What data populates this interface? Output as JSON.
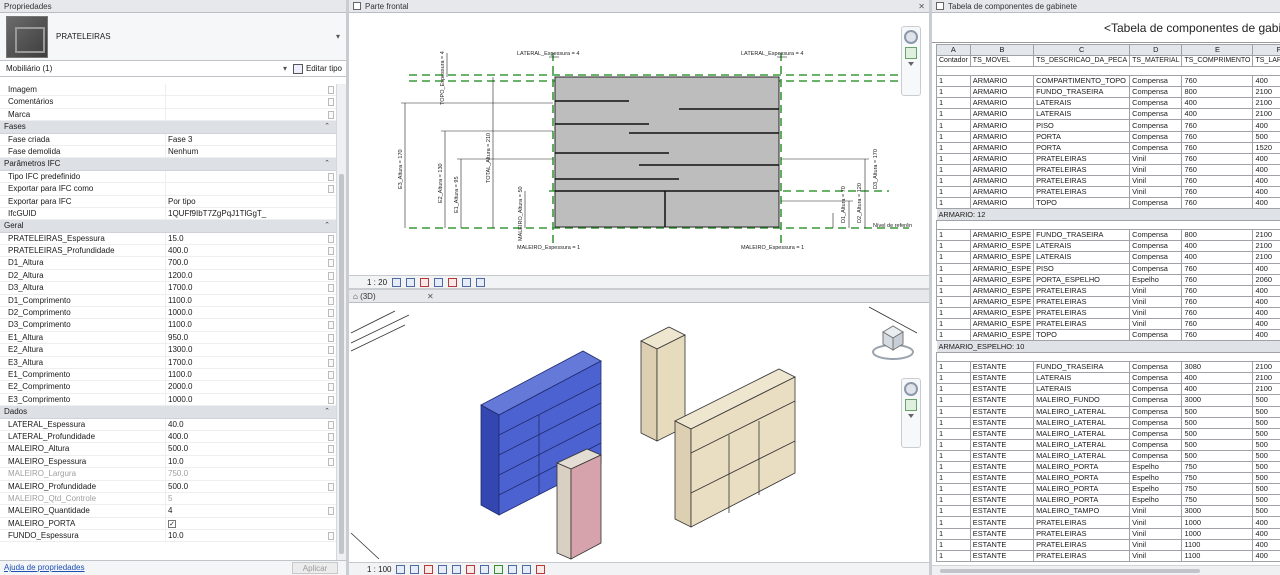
{
  "properties": {
    "title": "Propriedades",
    "type_name": "PRATELEIRAS",
    "instance_filter": "Mobiliário (1)",
    "edit_type_label": "Editar tipo",
    "help_link": "Ajuda de propriedades",
    "apply_label": "Aplicar",
    "rows": [
      {
        "kind": "row",
        "key": "Imagem",
        "value": ""
      },
      {
        "kind": "row",
        "key": "Comentários",
        "value": ""
      },
      {
        "kind": "row",
        "key": "Marca",
        "value": ""
      },
      {
        "kind": "section",
        "key": "Fases"
      },
      {
        "kind": "row",
        "key": "Fase criada",
        "value": "Fase 3"
      },
      {
        "kind": "row",
        "key": "Fase demolida",
        "value": "Nenhum"
      },
      {
        "kind": "section",
        "key": "Parâmetros IFC"
      },
      {
        "kind": "row",
        "key": "Tipo IFC predefinido",
        "value": ""
      },
      {
        "kind": "row",
        "key": "Exportar para IFC como",
        "value": ""
      },
      {
        "kind": "row",
        "key": "Exportar para IFC",
        "value": "Por tipo"
      },
      {
        "kind": "row",
        "key": "IfcGUID",
        "value": "1QUFf9IbT7ZgPqJ1TlGgT_"
      },
      {
        "kind": "section",
        "key": "Geral"
      },
      {
        "kind": "row",
        "key": "PRATELEIRAS_Espessura",
        "value": "15.0"
      },
      {
        "kind": "row",
        "key": "PRATELEIRAS_Profundidade",
        "value": "400.0"
      },
      {
        "kind": "row",
        "key": "D1_Altura",
        "value": "700.0"
      },
      {
        "kind": "row",
        "key": "D2_Altura",
        "value": "1200.0"
      },
      {
        "kind": "row",
        "key": "D3_Altura",
        "value": "1700.0"
      },
      {
        "kind": "row",
        "key": "D1_Comprimento",
        "value": "1100.0"
      },
      {
        "kind": "row",
        "key": "D2_Comprimento",
        "value": "1000.0"
      },
      {
        "kind": "row",
        "key": "D3_Comprimento",
        "value": "1100.0"
      },
      {
        "kind": "row",
        "key": "E1_Altura",
        "value": "950.0"
      },
      {
        "kind": "row",
        "key": "E2_Altura",
        "value": "1300.0"
      },
      {
        "kind": "row",
        "key": "E3_Altura",
        "value": "1700.0"
      },
      {
        "kind": "row",
        "key": "E1_Comprimento",
        "value": "1100.0"
      },
      {
        "kind": "row",
        "key": "E2_Comprimento",
        "value": "2000.0"
      },
      {
        "kind": "row",
        "key": "E3_Comprimento",
        "value": "1000.0"
      },
      {
        "kind": "section",
        "key": "Dados"
      },
      {
        "kind": "row",
        "key": "LATERAL_Espessura",
        "value": "40.0"
      },
      {
        "kind": "row",
        "key": "LATERAL_Profundidade",
        "value": "400.0"
      },
      {
        "kind": "row",
        "key": "MALEIRO_Altura",
        "value": "500.0"
      },
      {
        "kind": "row",
        "key": "MALEIRO_Espessura",
        "value": "10.0"
      },
      {
        "kind": "row",
        "key": "MALEIRO_Largura",
        "value": "750.0",
        "disabled": true
      },
      {
        "kind": "row",
        "key": "MALEIRO_Profundidade",
        "value": "500.0"
      },
      {
        "kind": "row",
        "key": "MALEIRO_Qtd_Controle",
        "value": "5",
        "disabled": true
      },
      {
        "kind": "row",
        "key": "MALEIRO_Quantidade",
        "value": "4"
      },
      {
        "kind": "row",
        "key": "MALEIRO_PORTA",
        "value": "",
        "checkbox": true
      },
      {
        "kind": "row",
        "key": "FUNDO_Espessura",
        "value": "10.0"
      }
    ]
  },
  "front_view": {
    "tab": "Parte frontal",
    "scale": "1 : 20",
    "labels": {
      "lateral_left": "LATERAL_Espessura = 4",
      "lateral_right": "LATERAL_Espessura = 4",
      "topo": "TOPO_Espessura = 4",
      "total": "TOTAL_Altura = 210",
      "e3": "E3_Altura = 170",
      "e2": "E2_Altura = 130",
      "e1": "E1_Altura = 95",
      "maleiro": "MALEIRO_Altura = 50",
      "d3": "D3_Altura = 170",
      "d2": "D2_Altura = 120",
      "d1": "D1_Altura = 70",
      "nivel": "Nível de referên",
      "maleiro_left": "MALEIRO_Espessura = 1",
      "maleiro_right": "MALEIRO_Espessura = 1"
    }
  },
  "view_3d": {
    "tab": "(3D)",
    "scale": "1 : 100"
  },
  "schedule": {
    "tab": "Tabela de componentes de gabinete",
    "title": "<Tabela de componentes de gabinet",
    "column_letters": [
      "A",
      "B",
      "C",
      "D",
      "E",
      "F"
    ],
    "headers": [
      "Contador",
      "TS_MOVEL",
      "TS_DESCRICAO_DA_PECA",
      "TS_MATERIAL",
      "TS_COMPRIMENTO",
      "TS_LARGURA"
    ],
    "rows": [
      {
        "t": "blank"
      },
      {
        "t": "r",
        "c": [
          "1",
          "ARMARIO",
          "COMPARTIMENTO_TOPO",
          "Compensa",
          "760",
          "400"
        ]
      },
      {
        "t": "r",
        "c": [
          "1",
          "ARMARIO",
          "FUNDO_TRASEIRA",
          "Compensa",
          "800",
          "2100"
        ]
      },
      {
        "t": "r",
        "c": [
          "1",
          "ARMARIO",
          "LATERAIS",
          "Compensa",
          "400",
          "2100"
        ]
      },
      {
        "t": "r",
        "c": [
          "1",
          "ARMARIO",
          "LATERAIS",
          "Compensa",
          "400",
          "2100"
        ]
      },
      {
        "t": "r",
        "c": [
          "1",
          "ARMARIO",
          "PISO",
          "Compensa",
          "760",
          "400"
        ]
      },
      {
        "t": "r",
        "c": [
          "1",
          "ARMARIO",
          "PORTA",
          "Compensa",
          "760",
          "500"
        ]
      },
      {
        "t": "r",
        "c": [
          "1",
          "ARMARIO",
          "PORTA",
          "Compensa",
          "760",
          "1520"
        ]
      },
      {
        "t": "r",
        "c": [
          "1",
          "ARMARIO",
          "PRATELEIRAS",
          "Vinil",
          "760",
          "400"
        ]
      },
      {
        "t": "r",
        "c": [
          "1",
          "ARMARIO",
          "PRATELEIRAS",
          "Vinil",
          "760",
          "400"
        ]
      },
      {
        "t": "r",
        "c": [
          "1",
          "ARMARIO",
          "PRATELEIRAS",
          "Vinil",
          "760",
          "400"
        ]
      },
      {
        "t": "r",
        "c": [
          "1",
          "ARMARIO",
          "PRATELEIRAS",
          "Vinil",
          "760",
          "400"
        ]
      },
      {
        "t": "r",
        "c": [
          "1",
          "ARMARIO",
          "TOPO",
          "Compensa",
          "760",
          "400"
        ]
      },
      {
        "t": "g",
        "label": "ARMARIO: 12"
      },
      {
        "t": "blank"
      },
      {
        "t": "r",
        "c": [
          "1",
          "ARMARIO_ESPE",
          "FUNDO_TRASEIRA",
          "Compensa",
          "800",
          "2100"
        ]
      },
      {
        "t": "r",
        "c": [
          "1",
          "ARMARIO_ESPE",
          "LATERAIS",
          "Compensa",
          "400",
          "2100"
        ]
      },
      {
        "t": "r",
        "c": [
          "1",
          "ARMARIO_ESPE",
          "LATERAIS",
          "Compensa",
          "400",
          "2100"
        ]
      },
      {
        "t": "r",
        "c": [
          "1",
          "ARMARIO_ESPE",
          "PISO",
          "Compensa",
          "760",
          "400"
        ]
      },
      {
        "t": "r",
        "c": [
          "1",
          "ARMARIO_ESPE",
          "PORTA_ESPELHO",
          "Espelho",
          "760",
          "2060"
        ]
      },
      {
        "t": "r",
        "c": [
          "1",
          "ARMARIO_ESPE",
          "PRATELEIRAS",
          "Vinil",
          "760",
          "400"
        ]
      },
      {
        "t": "r",
        "c": [
          "1",
          "ARMARIO_ESPE",
          "PRATELEIRAS",
          "Vinil",
          "760",
          "400"
        ]
      },
      {
        "t": "r",
        "c": [
          "1",
          "ARMARIO_ESPE",
          "PRATELEIRAS",
          "Vinil",
          "760",
          "400"
        ]
      },
      {
        "t": "r",
        "c": [
          "1",
          "ARMARIO_ESPE",
          "PRATELEIRAS",
          "Vinil",
          "760",
          "400"
        ]
      },
      {
        "t": "r",
        "c": [
          "1",
          "ARMARIO_ESPE",
          "TOPO",
          "Compensa",
          "760",
          "400"
        ]
      },
      {
        "t": "g",
        "label": "ARMARIO_ESPELHO: 10"
      },
      {
        "t": "blank"
      },
      {
        "t": "r",
        "c": [
          "1",
          "ESTANTE",
          "FUNDO_TRASEIRA",
          "Compensa",
          "3080",
          "2100"
        ]
      },
      {
        "t": "r",
        "c": [
          "1",
          "ESTANTE",
          "LATERAIS",
          "Compensa",
          "400",
          "2100"
        ]
      },
      {
        "t": "r",
        "c": [
          "1",
          "ESTANTE",
          "LATERAIS",
          "Compensa",
          "400",
          "2100"
        ]
      },
      {
        "t": "r",
        "c": [
          "1",
          "ESTANTE",
          "MALEIRO_FUNDO",
          "Compensa",
          "3000",
          "500"
        ]
      },
      {
        "t": "r",
        "c": [
          "1",
          "ESTANTE",
          "MALEIRO_LATERAL",
          "Compensa",
          "500",
          "500"
        ]
      },
      {
        "t": "r",
        "c": [
          "1",
          "ESTANTE",
          "MALEIRO_LATERAL",
          "Compensa",
          "500",
          "500"
        ]
      },
      {
        "t": "r",
        "c": [
          "1",
          "ESTANTE",
          "MALEIRO_LATERAL",
          "Compensa",
          "500",
          "500"
        ]
      },
      {
        "t": "r",
        "c": [
          "1",
          "ESTANTE",
          "MALEIRO_LATERAL",
          "Compensa",
          "500",
          "500"
        ]
      },
      {
        "t": "r",
        "c": [
          "1",
          "ESTANTE",
          "MALEIRO_LATERAL",
          "Compensa",
          "500",
          "500"
        ]
      },
      {
        "t": "r",
        "c": [
          "1",
          "ESTANTE",
          "MALEIRO_PORTA",
          "Espelho",
          "750",
          "500"
        ]
      },
      {
        "t": "r",
        "c": [
          "1",
          "ESTANTE",
          "MALEIRO_PORTA",
          "Espelho",
          "750",
          "500"
        ]
      },
      {
        "t": "r",
        "c": [
          "1",
          "ESTANTE",
          "MALEIRO_PORTA",
          "Espelho",
          "750",
          "500"
        ]
      },
      {
        "t": "r",
        "c": [
          "1",
          "ESTANTE",
          "MALEIRO_PORTA",
          "Espelho",
          "750",
          "500"
        ]
      },
      {
        "t": "r",
        "c": [
          "1",
          "ESTANTE",
          "MALEIRO_TAMPO",
          "Vinil",
          "3000",
          "500"
        ]
      },
      {
        "t": "r",
        "c": [
          "1",
          "ESTANTE",
          "PRATELEIRAS",
          "Vinil",
          "1000",
          "400"
        ]
      },
      {
        "t": "r",
        "c": [
          "1",
          "ESTANTE",
          "PRATELEIRAS",
          "Vinil",
          "1000",
          "400"
        ]
      },
      {
        "t": "r",
        "c": [
          "1",
          "ESTANTE",
          "PRATELEIRAS",
          "Vinil",
          "1100",
          "400"
        ]
      },
      {
        "t": "r",
        "c": [
          "1",
          "ESTANTE",
          "PRATELEIRAS",
          "Vinil",
          "1100",
          "400"
        ]
      }
    ]
  }
}
